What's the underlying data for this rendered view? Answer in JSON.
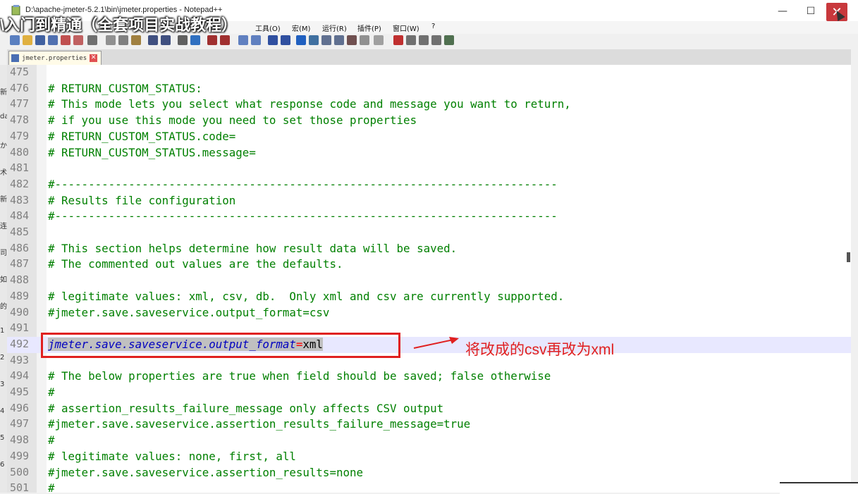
{
  "window": {
    "title": "D:\\apache-jmeter-5.2.1\\bin\\jmeter.properties - Notepad++",
    "minimize": "—",
    "maximize": "☐",
    "close": "✕"
  },
  "overlay": {
    "video_title": "\\入门到精通（全套项目实战教程）"
  },
  "menu": [
    "工具(O)",
    "宏(M)",
    "运行(R)",
    "插件(P)",
    "窗口(W)",
    "?"
  ],
  "tab": {
    "label": "jmeter.properties"
  },
  "left_strip_chars": [
    "新",
    "da",
    "か",
    "术",
    "新",
    "连",
    "司",
    "如",
    "的",
    "1",
    "2",
    "3",
    "4",
    "5",
    "6"
  ],
  "editor": {
    "lines": [
      {
        "n": "475",
        "text": ""
      },
      {
        "n": "476",
        "text": "# RETURN_CUSTOM_STATUS:"
      },
      {
        "n": "477",
        "text": "# This mode lets you select what response code and message you want to return,"
      },
      {
        "n": "478",
        "text": "# if you use this mode you need to set those properties"
      },
      {
        "n": "479",
        "text": "# RETURN_CUSTOM_STATUS.code="
      },
      {
        "n": "480",
        "text": "# RETURN_CUSTOM_STATUS.message="
      },
      {
        "n": "481",
        "text": ""
      },
      {
        "n": "482",
        "text": "#---------------------------------------------------------------------------"
      },
      {
        "n": "483",
        "text": "# Results file configuration"
      },
      {
        "n": "484",
        "text": "#---------------------------------------------------------------------------"
      },
      {
        "n": "485",
        "text": ""
      },
      {
        "n": "486",
        "text": "# This section helps determine how result data will be saved."
      },
      {
        "n": "487",
        "text": "# The commented out values are the defaults."
      },
      {
        "n": "488",
        "text": ""
      },
      {
        "n": "489",
        "text": "# legitimate values: xml, csv, db.  Only xml and csv are currently supported."
      },
      {
        "n": "490",
        "text": "#jmeter.save.saveservice.output_format=csv"
      },
      {
        "n": "491",
        "text": ""
      },
      {
        "n": "492",
        "text": ""
      },
      {
        "n": "493",
        "text": ""
      },
      {
        "n": "494",
        "text": "# The below properties are true when field should be saved; false otherwise"
      },
      {
        "n": "495",
        "text": "#"
      },
      {
        "n": "496",
        "text": "# assertion_results_failure_message only affects CSV output"
      },
      {
        "n": "497",
        "text": "#jmeter.save.saveservice.assertion_results_failure_message=true"
      },
      {
        "n": "498",
        "text": "#"
      },
      {
        "n": "499",
        "text": "# legitimate values: none, first, all"
      },
      {
        "n": "500",
        "text": "#jmeter.save.saveservice.assertion_results=none"
      },
      {
        "n": "501",
        "text": "#"
      }
    ],
    "active_line": {
      "key": "jmeter.save.saveservice.output_format",
      "op": "=",
      "value": "xml"
    }
  },
  "annotation": {
    "text": "将改成的csv再改为xml",
    "color": "#e02020"
  }
}
